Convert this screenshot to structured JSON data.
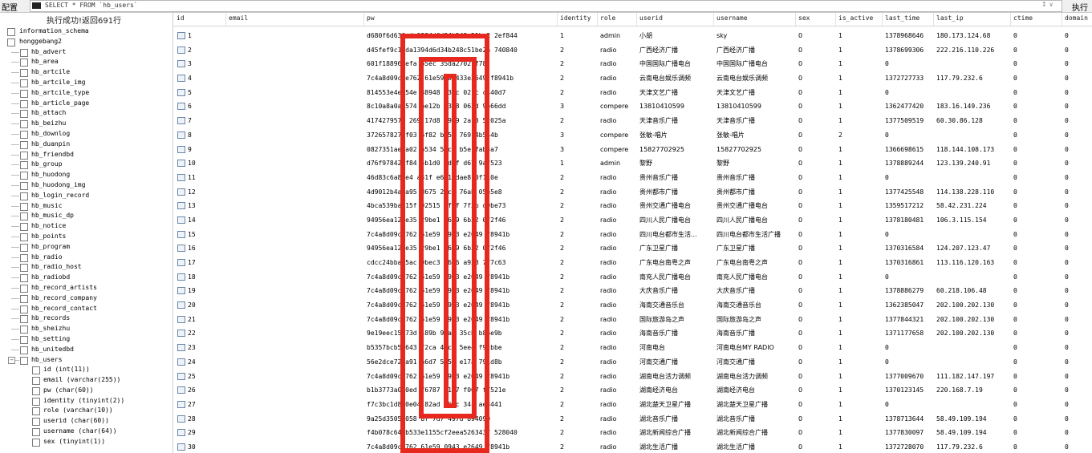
{
  "topbar": {
    "config_label": "配置",
    "sql": "SELECT * FROM `hb_users`",
    "arrows": "↕ ∨",
    "execute_label": "执行"
  },
  "left_panel": {
    "status": "执行成功!返回691行",
    "databases": [
      "information_schema",
      "honggebang2"
    ],
    "tables": [
      "hb_advert",
      "hb_area",
      "hb_artcile",
      "hb_artcile_img",
      "hb_artcile_type",
      "hb_article_page",
      "hb_attach",
      "hb_beizhu",
      "hb_downlog",
      "hb_duanpin",
      "hb_friendbd",
      "hb_group",
      "hb_huodong",
      "hb_huodong_img",
      "hb_login_record",
      "hb_music",
      "hb_music_dp",
      "hb_notice",
      "hb_points",
      "hb_program",
      "hb_radio",
      "hb_radio_host",
      "hb_radiobd",
      "hb_record_artists",
      "hb_record_company",
      "hb_record_contact",
      "hb_records",
      "hb_sheizhu",
      "hb_setting",
      "hb_unitedbd"
    ],
    "open_table": "hb_users",
    "columns": [
      "id (int(11))",
      "email (varchar(255))",
      "pw (char(60))",
      "identity (tinyint(2))",
      "role (varchar(10))",
      "userid (char(60))",
      "username (char(64))",
      "sex (tinyint(1))"
    ]
  },
  "grid": {
    "headers": [
      "id",
      "email",
      "pw",
      "identity",
      "role",
      "userid",
      "username",
      "sex",
      "is_active",
      "last_time",
      "last_ip",
      "ctime",
      "domain"
    ],
    "rows": [
      [
        "1",
        "",
        "d680f6d636         da1394d6d34b248c51be2  2ef844",
        "1",
        "admin",
        "小胡",
        "sky",
        "0",
        "1",
        "1378968646",
        "180.173.124.68",
        "0",
        "0"
      ],
      [
        "2",
        "",
        "d45fef9c1    da1394d6d34b248c51be2a   740840",
        "2",
        "radio",
        "广西经济广播",
        "广西经济广播",
        "0",
        "1",
        "1378699306",
        "222.216.110.226",
        "0",
        "0"
      ],
      [
        "3",
        "",
        "601f18896    efa    b5ec      35da27027f78",
        "2",
        "radio",
        "中国国际广播电台",
        "中国国际广播电台",
        "0",
        "1",
        "0",
        "",
        "0",
        "0"
      ],
      [
        "4",
        "",
        "7c4a8d09c  e762  61e59  09433e2649  f8941b",
        "2",
        "radio",
        "云南电台娱乐调频",
        "云南电台娱乐调频",
        "0",
        "1",
        "1372727733",
        "117.79.232.6",
        "0",
        "0"
      ],
      [
        "5",
        "",
        "814553e4e  54e  88948  d37c  021c  c440d7",
        "2",
        "radio",
        "天津文艺广播",
        "天津文艺广播",
        "0",
        "1",
        "0",
        "",
        "0",
        "0"
      ],
      [
        "6",
        "",
        "8c10a8a0a  574  be12b  2358  063d  9e66dd",
        "3",
        "compere",
        "13810410599",
        "13810410599",
        "0",
        "1",
        "1362477420",
        "183.16.149.236",
        "0",
        "0"
      ],
      [
        "7",
        "",
        "4174279577  269  17d8  49e9  2af3  5c025a",
        "2",
        "radio",
        "天津音乐广播",
        "天津音乐广播",
        "0",
        "1",
        "1377509519",
        "60.30.86.128",
        "0",
        "0"
      ],
      [
        "8",
        "",
        "372657827  f03  6f82  b058  769  4b544b",
        "3",
        "compere",
        "张敏-唱片",
        "张敏-唱片",
        "0",
        "2",
        "0",
        "",
        "0",
        "0"
      ],
      [
        "9",
        "",
        "0827351ae  a02  b534  57c4  b5e  fab3a7",
        "3",
        "compere",
        "15827702925",
        "15827702925",
        "0",
        "1",
        "1366698615",
        "118.144.108.173",
        "0",
        "0"
      ],
      [
        "10",
        "",
        "d76f97842  f84  5b1d0  ad9f  d67  9af523",
        "1",
        "admin",
        "黎野",
        "黎野",
        "0",
        "1",
        "1378889244",
        "123.139.240.91",
        "0",
        "0"
      ],
      [
        "11",
        "",
        "46d83c6a8  e4  a31f  e601  dae8  0f110e",
        "2",
        "radio",
        "贵州音乐广播",
        "贵州音乐广播",
        "0",
        "1",
        "0",
        "",
        "0",
        "0"
      ],
      [
        "12",
        "",
        "4d9012b4a  a95  d675  27c3  76ab  05e5e8",
        "2",
        "radio",
        "贵州都市广播",
        "贵州都市广播",
        "0",
        "1",
        "1377425548",
        "114.138.228.110",
        "0",
        "0"
      ],
      [
        "13",
        "",
        "4bca539ba  15f  92515  bf5f  7f3b  d9be73",
        "2",
        "radio",
        "贵州交通广播电台",
        "贵州交通广播电台",
        "0",
        "1",
        "1359517212",
        "58.42.231.224",
        "0",
        "0"
      ],
      [
        "14",
        "",
        "94956ea12  e35  29be1  9699  6b22  0f2f46",
        "2",
        "radio",
        "四川人民广播电台",
        "四川人民广播电台",
        "0",
        "1",
        "1378180481",
        "106.3.115.154",
        "0",
        "0"
      ],
      [
        "15",
        "",
        "7c4a8d09c  762  61e59  0943  e2649  f8941b",
        "2",
        "radio",
        "四川电台都市生活...",
        "四川电台都市生活广播",
        "0",
        "1",
        "0",
        "",
        "0",
        "0"
      ],
      [
        "16",
        "",
        "94956ea12  e35  29be1  9699  6b22  0f2f46",
        "2",
        "radio",
        "广东卫星广播",
        "广东卫星广播",
        "0",
        "1",
        "1370316584",
        "124.207.123.47",
        "0",
        "0"
      ],
      [
        "17",
        "",
        "cdcc24bba  5ac  0bec3  3676  a938  777c63",
        "2",
        "radio",
        "广东电台南粤之声",
        "广东电台南粤之声",
        "0",
        "1",
        "1370316861",
        "113.116.120.163",
        "0",
        "0"
      ],
      [
        "18",
        "",
        "7c4a8d09c  762  61e59  0943  e2649  f8941b",
        "2",
        "radio",
        "南充人民广播电台",
        "南充人民广播电台",
        "0",
        "1",
        "0",
        "",
        "0",
        "0"
      ],
      [
        "19",
        "",
        "7c4a8d09c  762  61e59  0943  e2649  f8941b",
        "2",
        "radio",
        "大庆音乐广播",
        "大庆音乐广播",
        "0",
        "1",
        "1378886279",
        "60.218.106.48",
        "0",
        "0"
      ],
      [
        "20",
        "",
        "7c4a8d09c  762  61e59  0943  e2649  f8941b",
        "2",
        "radio",
        "海南交通音乐台",
        "海南交通音乐台",
        "0",
        "1",
        "1362385047",
        "202.100.202.130",
        "0",
        "0"
      ],
      [
        "21",
        "",
        "7c4a8d09c  762  61e59  0943  e2649  f8941b",
        "2",
        "radio",
        "国际旅游岛之声",
        "国际旅游岛之声",
        "0",
        "1",
        "1377844321",
        "202.100.202.130",
        "0",
        "0"
      ],
      [
        "22",
        "",
        "9e19eec15  73d  489b  9ea3  35cb  b86e9b",
        "2",
        "radio",
        "海南音乐广播",
        "海南音乐广播",
        "0",
        "1",
        "1371177658",
        "202.100.202.130",
        "0",
        "0"
      ],
      [
        "23",
        "",
        "b5357bcb5  643  f2ca  4eca  5ee4  f9cbbe",
        "2",
        "radio",
        "河南电台",
        "河南电台MY RADIO",
        "0",
        "1",
        "0",
        "",
        "0",
        "0"
      ],
      [
        "24",
        "",
        "56e2dce72  a91  a6d7  525d  e17a  791d8b",
        "2",
        "radio",
        "河南交通广播",
        "河南交通广播",
        "0",
        "1",
        "0",
        "",
        "0",
        "0"
      ],
      [
        "25",
        "",
        "7c4a8d09c  762  61e59  0943  e2649  f8941b",
        "2",
        "radio",
        "湖南电台活力调频",
        "湖南电台活力调频",
        "0",
        "1",
        "1377009670",
        "111.182.147.197",
        "0",
        "0"
      ],
      [
        "26",
        "",
        "b1b3773a0  0ed  76787  f157  f007  f7521e",
        "2",
        "radio",
        "湖南经济电台",
        "湖南经济电台",
        "0",
        "1",
        "1370123145",
        "220.168.7.19",
        "0",
        "0"
      ],
      [
        "27",
        "",
        "f7c3bc1d8  0e04  82ad  965c  34c  ae3441",
        "2",
        "radio",
        "湖北楚天卫星广播",
        "湖北楚天卫星广播",
        "0",
        "1",
        "0",
        "",
        "0",
        "0"
      ],
      [
        "28",
        "",
        "9a25d3505  058      8f  7d7  497d  894099",
        "2",
        "radio",
        "湖北音乐广播",
        "湖北音乐广播",
        "0",
        "1",
        "1378713644",
        "58.49.109.194",
        "0",
        "0"
      ],
      [
        "29",
        "",
        "f4b078c64  b533e1155cf2eea5263437  528040",
        "2",
        "radio",
        "湖北新闻综合广播",
        "湖北新闻综合广播",
        "0",
        "1",
        "1377830097",
        "58.49.109.194",
        "0",
        "0"
      ],
      [
        "30",
        "",
        "7c4a8d09c  762  61e59  0943  e2649  f8941b",
        "2",
        "radio",
        "湖北生活广播",
        "湖北生活广播",
        "0",
        "1",
        "1372728070",
        "117.79.232.6",
        "0",
        "0"
      ]
    ]
  },
  "colors": {
    "annotation": "#e6281e",
    "row_icon": "#6a86a8"
  }
}
